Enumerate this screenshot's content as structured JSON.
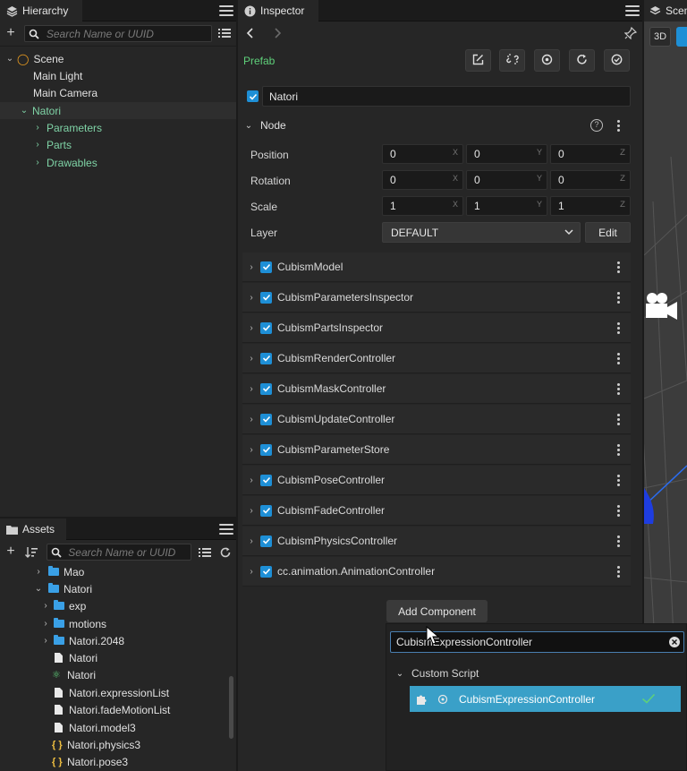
{
  "hierarchy": {
    "title": "Hierarchy",
    "search_placeholder": "Search Name or UUID",
    "items": [
      {
        "label": "Scene"
      },
      {
        "label": "Main Light"
      },
      {
        "label": "Main Camera"
      },
      {
        "label": "Natori"
      },
      {
        "label": "Parameters"
      },
      {
        "label": "Parts"
      },
      {
        "label": "Drawables"
      }
    ]
  },
  "assets": {
    "title": "Assets",
    "search_placeholder": "Search Name or UUID",
    "items": [
      {
        "label": "Mao"
      },
      {
        "label": "Natori"
      },
      {
        "label": "exp"
      },
      {
        "label": "motions"
      },
      {
        "label": "Natori.2048"
      },
      {
        "label": "Natori"
      },
      {
        "label": "Natori"
      },
      {
        "label": "Natori.expressionList"
      },
      {
        "label": "Natori.fadeMotionList"
      },
      {
        "label": "Natori.model3"
      },
      {
        "label": "Natori.physics3"
      },
      {
        "label": "Natori.pose3"
      }
    ]
  },
  "inspector": {
    "title": "Inspector",
    "prefab_label": "Prefab",
    "node_name": "Natori",
    "node_section": "Node",
    "props": {
      "position": {
        "label": "Position",
        "x": "0",
        "y": "0",
        "z": "0"
      },
      "rotation": {
        "label": "Rotation",
        "x": "0",
        "y": "0",
        "z": "0"
      },
      "scale": {
        "label": "Scale",
        "x": "1",
        "y": "1",
        "z": "1"
      },
      "layer": {
        "label": "Layer",
        "value": "DEFAULT",
        "edit_label": "Edit"
      }
    },
    "axes": {
      "x": "X",
      "y": "Y",
      "z": "Z"
    },
    "components": [
      {
        "name": "CubismModel"
      },
      {
        "name": "CubismParametersInspector"
      },
      {
        "name": "CubismPartsInspector"
      },
      {
        "name": "CubismRenderController"
      },
      {
        "name": "CubismMaskController"
      },
      {
        "name": "CubismUpdateController"
      },
      {
        "name": "CubismParameterStore"
      },
      {
        "name": "CubismPoseController"
      },
      {
        "name": "CubismFadeController"
      },
      {
        "name": "CubismPhysicsController"
      },
      {
        "name": "cc.animation.AnimationController"
      }
    ],
    "add_component_label": "Add Component"
  },
  "dropdown": {
    "search_value": "CubismExpressionController",
    "group_label": "Custom Script",
    "result_label": "CubismExpressionController"
  },
  "scene": {
    "title": "Scene",
    "mode_label": "3D"
  },
  "colors": {
    "accent_blue": "#1e8fd6",
    "selection_blue": "#3aa0c8",
    "green_text": "#7fd3a6",
    "prefab_green": "#5fd07a"
  }
}
